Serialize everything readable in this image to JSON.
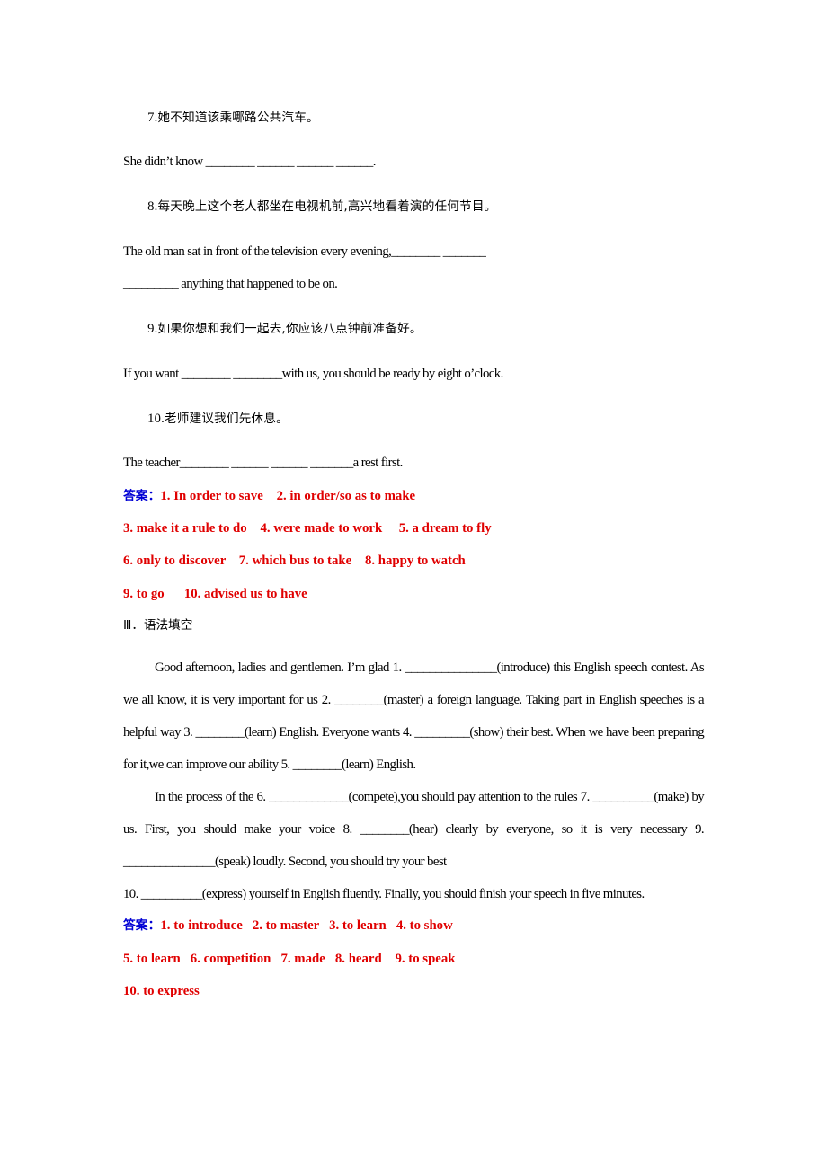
{
  "document": {
    "language": "zh-CN + en",
    "colors": {
      "answer_red": "#E00000",
      "answer_label_blue": "#0000D4",
      "body_black": "#000000"
    }
  },
  "translation_exercise": {
    "items": [
      {
        "number": "7.",
        "chinese": "她不知道该乘哪路公共汽车。",
        "english_lines": [
          "She didn’t know ________ ______ ______ ______."
        ]
      },
      {
        "number": "8.",
        "chinese": "每天晚上这个老人都坐在电视机前,高兴地看着演的任何节目。",
        "english_lines": [
          "The old man sat in front of the television every evening,________ _______",
          "_________ anything that happened to be on."
        ]
      },
      {
        "number": "9.",
        "chinese": "如果你想和我们一起去,你应该八点钟前准备好。",
        "english_lines": [
          "If you want ________ ________with us, you should be ready by eight o’clock."
        ]
      },
      {
        "number": "10.",
        "chinese": "老师建议我们先休息。",
        "english_lines": [
          "The teacher________ ______ ______ _______a rest first."
        ]
      }
    ],
    "answers_label": "答案：",
    "answers_lines": [
      "1. In order to save    2. in order/so as to make",
      "3. make it a rule to do    4. were made to work     5. a dream to fly",
      "6. only to discover    7. which bus to take    8. happy to watch",
      "9. to go      10. advised us to have"
    ]
  },
  "grammar_fill": {
    "heading": "Ⅲ．语法填空",
    "paragraphs": [
      "Good afternoon, ladies and gentlemen. I’m glad 1. _______________(introduce) this English speech contest. As we all know, it is very important for us 2. ________(master) a foreign language. Taking part in English speeches is a helpful way 3. ________(learn) English. Everyone wants 4. _________(show) their best. When we have been preparing for it,we can improve our ability 5. ________(learn) English.",
      "In the process of the 6. _____________(compete),you should pay attention to the rules 7. __________(make) by us. First, you should make your voice 8. ________(hear) clearly by everyone, so it is very necessary 9. _______________(speak) loudly. Second, you should try your best",
      "10. __________(express) yourself in English fluently. Finally, you should finish your speech in five minutes."
    ],
    "answers_label": "答案：",
    "answers_lines": [
      "1. to introduce   2. to master   3. to learn   4. to show",
      "5. to learn   6. competition   7. made   8. heard    9. to speak",
      "10. to express"
    ]
  }
}
